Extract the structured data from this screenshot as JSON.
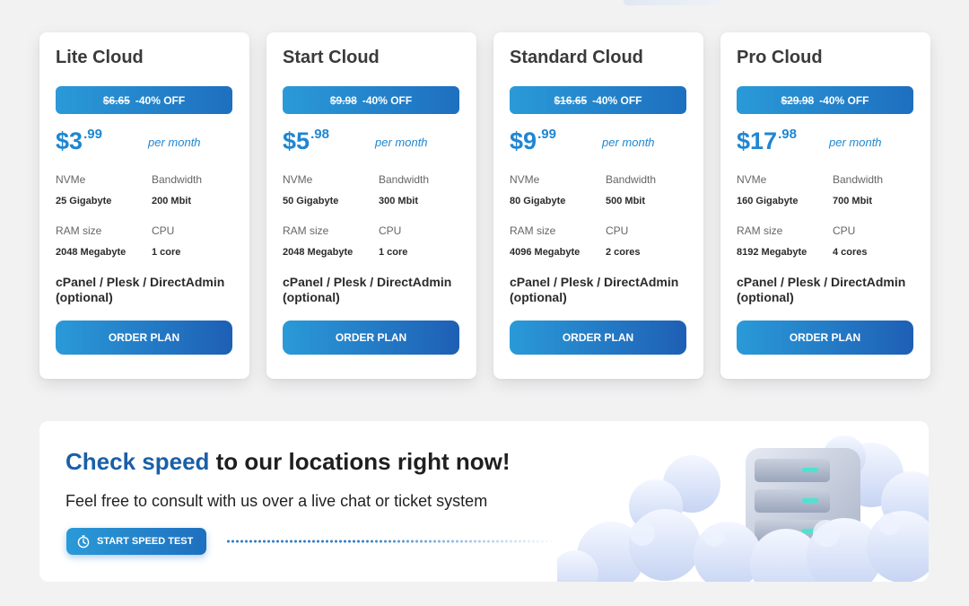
{
  "plans": [
    {
      "name": "Lite Cloud",
      "old_price": "$6.65",
      "discount": "-40% OFF",
      "price_currency": "$",
      "price_int": "3",
      "price_cents": ".99",
      "period": "per month",
      "nvme_label": "NVMe",
      "nvme_value": "25 Gigabyte",
      "bandwidth_label": "Bandwidth",
      "bandwidth_value": "200 Mbit",
      "ram_label": "RAM size",
      "ram_value": "2048 Megabyte",
      "cpu_label": "CPU",
      "cpu_value": "1 core",
      "panels": "cPanel / Plesk / DirectAdmin (optional)",
      "order_label": "ORDER PLAN"
    },
    {
      "name": "Start Cloud",
      "old_price": "$9.98",
      "discount": "-40% OFF",
      "price_currency": "$",
      "price_int": "5",
      "price_cents": ".98",
      "period": "per month",
      "nvme_label": "NVMe",
      "nvme_value": "50 Gigabyte",
      "bandwidth_label": "Bandwidth",
      "bandwidth_value": "300 Mbit",
      "ram_label": "RAM size",
      "ram_value": "2048 Megabyte",
      "cpu_label": "CPU",
      "cpu_value": "1 core",
      "panels": "cPanel / Plesk / DirectAdmin (optional)",
      "order_label": "ORDER PLAN"
    },
    {
      "name": "Standard Cloud",
      "old_price": "$16.65",
      "discount": "-40% OFF",
      "price_currency": "$",
      "price_int": "9",
      "price_cents": ".99",
      "period": "per month",
      "nvme_label": "NVMe",
      "nvme_value": "80 Gigabyte",
      "bandwidth_label": "Bandwidth",
      "bandwidth_value": "500 Mbit",
      "ram_label": "RAM size",
      "ram_value": "4096 Megabyte",
      "cpu_label": "CPU",
      "cpu_value": "2 cores",
      "panels": "cPanel / Plesk / DirectAdmin (optional)",
      "order_label": "ORDER PLAN"
    },
    {
      "name": "Pro Cloud",
      "old_price": "$29.98",
      "discount": "-40% OFF",
      "price_currency": "$",
      "price_int": "17",
      "price_cents": ".98",
      "period": "per month",
      "nvme_label": "NVMe",
      "nvme_value": "160 Gigabyte",
      "bandwidth_label": "Bandwidth",
      "bandwidth_value": "700 Mbit",
      "ram_label": "RAM size",
      "ram_value": "8192 Megabyte",
      "cpu_label": "CPU",
      "cpu_value": "4 cores",
      "panels": "cPanel / Plesk / DirectAdmin (optional)",
      "order_label": "ORDER PLAN"
    }
  ],
  "banner": {
    "title_accent": "Check speed",
    "title_rest": " to our locations right now!",
    "subtitle": "Feel free to consult with us over a live chat or ticket system",
    "button_label": "START SPEED TEST",
    "button_icon": "stopwatch-icon",
    "illustration": "server-in-clouds"
  },
  "colors": {
    "accent_blue": "#1f86d2",
    "dark_blue": "#1a5fa8",
    "gradient_start": "#2a9ad8",
    "gradient_end": "#1e5fb5"
  }
}
